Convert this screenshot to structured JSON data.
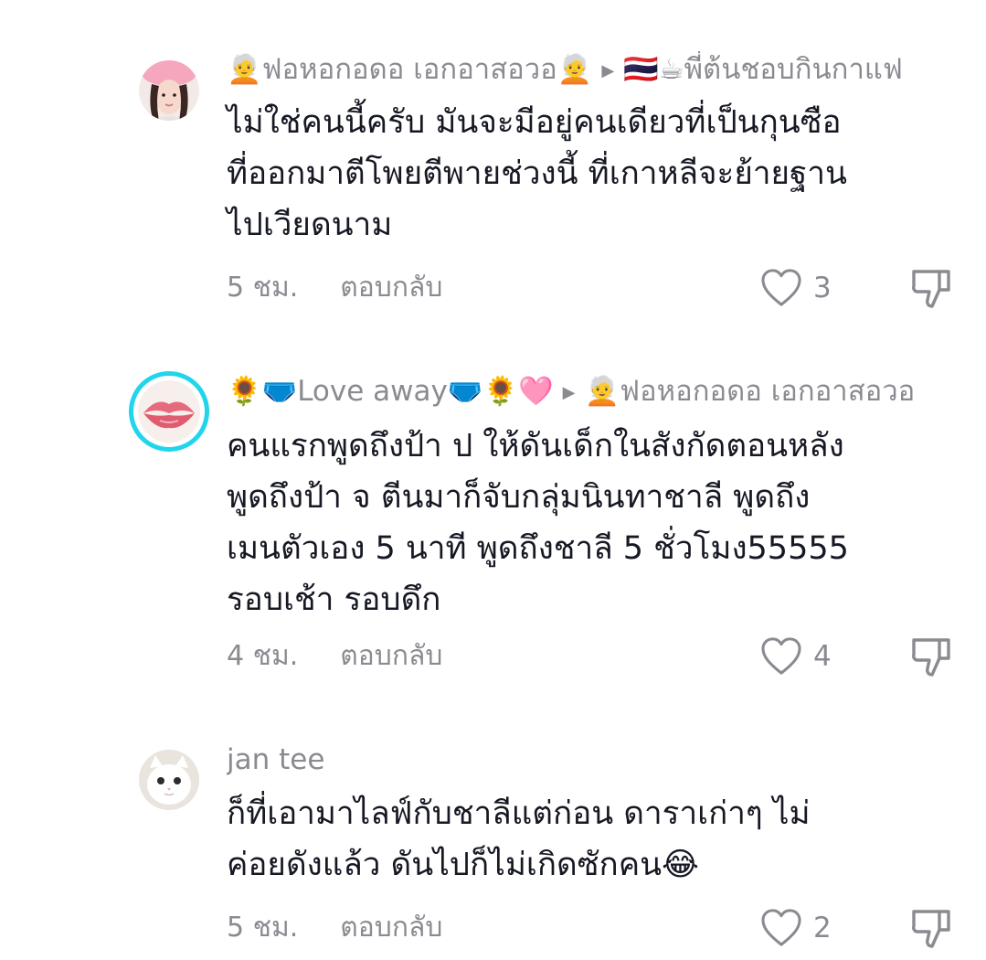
{
  "comments": [
    {
      "username": "🧑‍🦳ฟอหอกอดอ เอกอาสอวอ🧑‍🦳",
      "reply_to": "🇹🇭☕พี่ต้นชอบกินกาแฟ",
      "avatar_icon": "girl-with-pink-hat-avatar",
      "text_lines": [
        "ไม่ใช่คนนี้ครับ มันจะมีอยู่คนเดียวที่เป็นกุนซือ",
        "ที่ออกมาตีโพยตีพายช่วงนี้ ที่เกาหลีจะย้ายฐาน",
        "ไปเวียดนาม"
      ],
      "time": "5 ชม.",
      "reply_label": "ตอบกลับ",
      "likes": "3"
    },
    {
      "username": "🌻🩲Love away🩲🌻🩷",
      "reply_to": "🧑‍🦳ฟอหอกอดอ เอกอาสอวอ",
      "avatar_icon": "lips-avatar",
      "text_lines": [
        "คนแรกพูดถึงป้า ป ให้ดันเด็กในสังกัดตอนหลัง",
        "พูดถึงป้า จ ตีนมาก็จับกลุ่มนินทาชาลี พูดถึง",
        "เมนตัวเอง 5 นาที พูดถึงชาลี 5 ชั่วโมง55555",
        "รอบเช้า รอบดึก"
      ],
      "time": "4 ชม.",
      "reply_label": "ตอบกลับ",
      "likes": "4"
    },
    {
      "username": "jan tee",
      "avatar_icon": "white-cat-avatar",
      "text_lines": [
        "ก็ที่เอามาไลฟ์กับชาลีแต่ก่อน ดาราเก่าๆ ไม่",
        "ค่อยดังแล้ว ดันไปก็ไม่เกิดซักคน😂"
      ],
      "time": "5 ชม.",
      "reply_label": "ตอบกลับ",
      "likes": "2"
    }
  ],
  "colors": {
    "text": "#161823",
    "secondary": "#8a8b91",
    "story_ring": "#20d5ec"
  }
}
